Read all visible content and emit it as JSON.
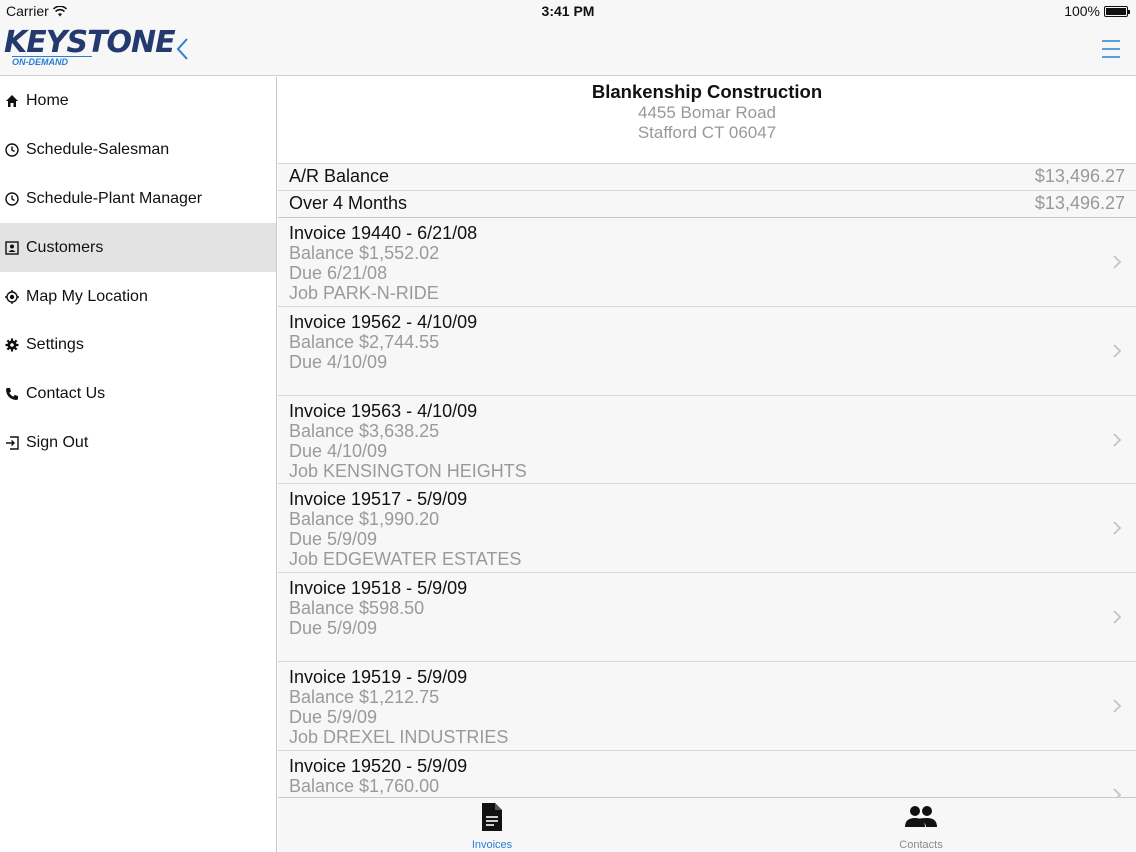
{
  "statusbar": {
    "carrier": "Carrier",
    "time": "3:41 PM",
    "battery": "100%"
  },
  "app": {
    "logo_main": "KEYSTONE",
    "logo_sub": "ON-DEMAND"
  },
  "sidebar": {
    "items": [
      {
        "label": "Home",
        "icon": "home-icon"
      },
      {
        "label": "Schedule-Salesman",
        "icon": "clock-icon"
      },
      {
        "label": "Schedule-Plant Manager",
        "icon": "clock-icon"
      },
      {
        "label": "Customers",
        "icon": "contact-card-icon",
        "active": true
      },
      {
        "label": "Map My Location",
        "icon": "location-icon"
      },
      {
        "label": "Settings",
        "icon": "gear-icon"
      },
      {
        "label": "Contact Us",
        "icon": "phone-icon"
      },
      {
        "label": "Sign Out",
        "icon": "sign-out-icon"
      }
    ]
  },
  "customer": {
    "name": "Blankenship Construction",
    "address1": "4455 Bomar Road",
    "address2": "Stafford CT 06047"
  },
  "summary": [
    {
      "label": "A/R Balance",
      "value": "$13,496.27"
    },
    {
      "label": "Over 4 Months",
      "value": "$13,496.27"
    }
  ],
  "invoices": [
    {
      "title": "Invoice 19440 - 6/21/08",
      "balance": "Balance $1,552.02",
      "due": "Due 6/21/08",
      "job": "Job PARK-N-RIDE"
    },
    {
      "title": "Invoice 19562 - 4/10/09",
      "balance": "Balance $2,744.55",
      "due": "Due 4/10/09",
      "job": ""
    },
    {
      "title": "Invoice 19563 - 4/10/09",
      "balance": "Balance $3,638.25",
      "due": "Due 4/10/09",
      "job": "Job KENSINGTON HEIGHTS"
    },
    {
      "title": "Invoice 19517 - 5/9/09",
      "balance": "Balance $1,990.20",
      "due": "Due 5/9/09",
      "job": "Job EDGEWATER ESTATES"
    },
    {
      "title": "Invoice 19518 - 5/9/09",
      "balance": "Balance $598.50",
      "due": "Due 5/9/09",
      "job": ""
    },
    {
      "title": "Invoice 19519 - 5/9/09",
      "balance": "Balance $1,212.75",
      "due": "Due 5/9/09",
      "job": "Job DREXEL INDUSTRIES"
    },
    {
      "title": "Invoice 19520 - 5/9/09",
      "balance": "Balance $1,760.00",
      "due": "",
      "job": ""
    }
  ],
  "tabs": [
    {
      "label": "Invoices",
      "icon": "document-icon",
      "selected": true
    },
    {
      "label": "Contacts",
      "icon": "people-icon",
      "selected": false
    }
  ],
  "colors": {
    "accent": "#2a7fd4",
    "active_row": "#e3e3e3",
    "secondary_text": "#9a9a9a"
  }
}
